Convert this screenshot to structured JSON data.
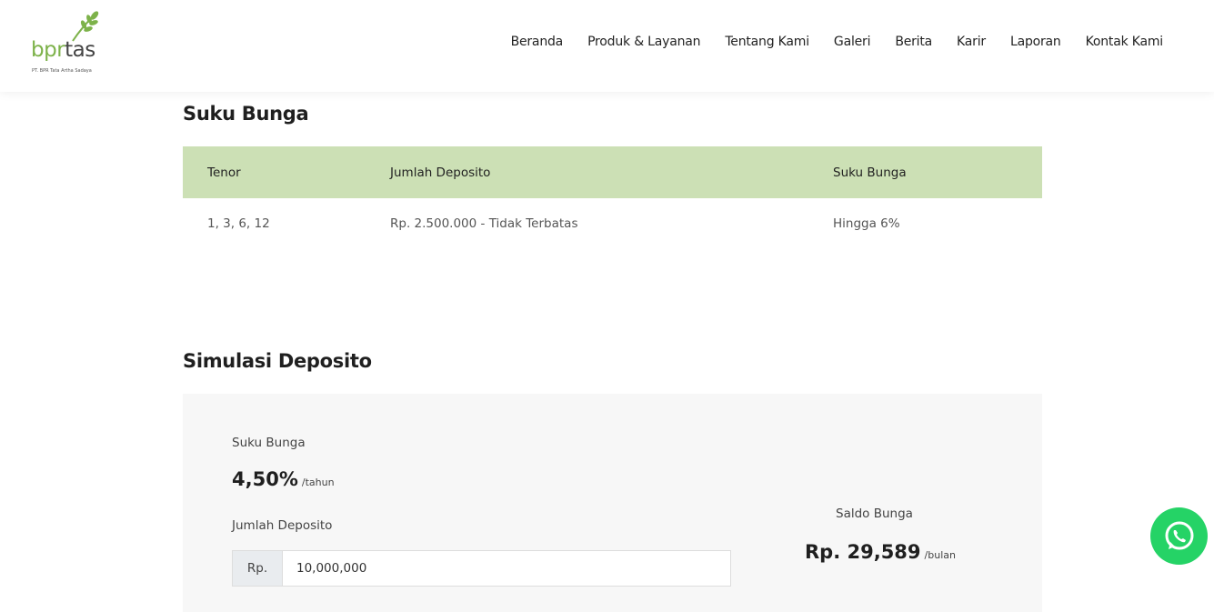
{
  "brand": {
    "name_part1": "bpr",
    "name_part2": "tas",
    "subtitle": "PT. BPR Tata Artha Sadaya",
    "color": "#7db24a"
  },
  "nav": {
    "items": [
      "Beranda",
      "Produk & Layanan",
      "Tentang Kami",
      "Galeri",
      "Berita",
      "Karir",
      "Laporan",
      "Kontak Kami"
    ]
  },
  "rates": {
    "title": "Suku Bunga",
    "header_color": "#cce0b5",
    "columns": [
      "Tenor",
      "Jumlah Deposito",
      "Suku Bunga"
    ],
    "rows": [
      [
        "1, 3, 6, 12",
        "Rp. 2.500.000 - Tidak Terbatas",
        "Hingga 6%"
      ]
    ]
  },
  "simulation": {
    "title": "Simulasi Deposito",
    "rate_label": "Suku Bunga",
    "rate_value": "4,50%",
    "rate_unit": "/tahun",
    "amount_label": "Jumlah Deposito",
    "amount_prefix": "Rp.",
    "amount_value": "10,000,000",
    "result_label": "Saldo Bunga",
    "result_value": "Rp. 29,589",
    "result_unit": "/bulan"
  },
  "whatsapp": {
    "icon": "whatsapp-icon",
    "color": "#25d366"
  }
}
